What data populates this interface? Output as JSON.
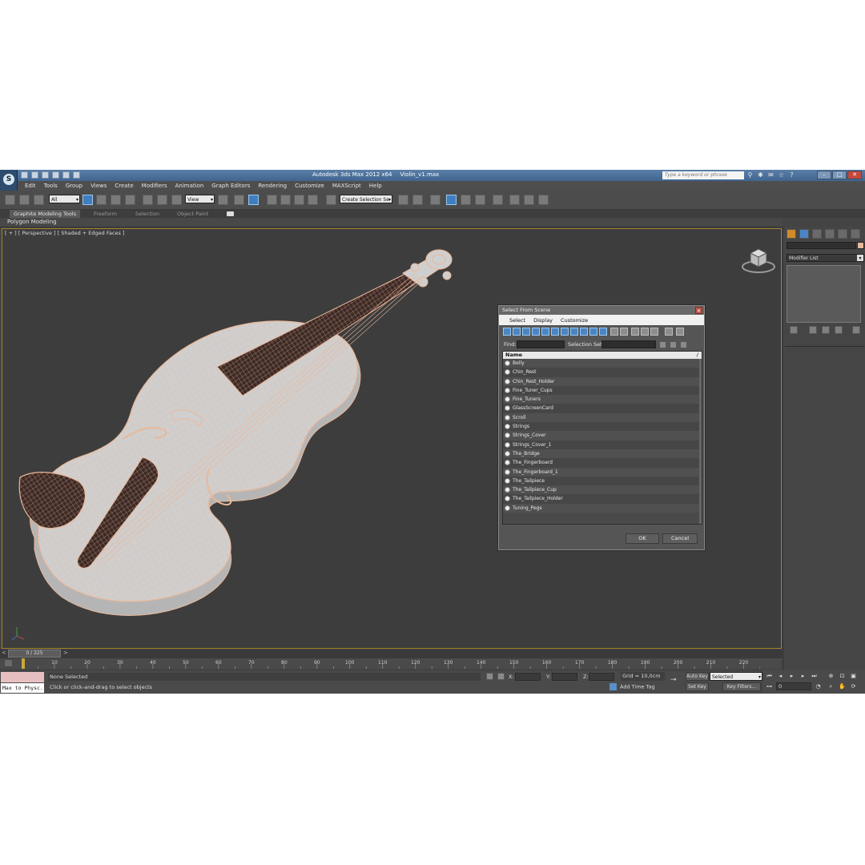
{
  "window": {
    "title": "Autodesk 3ds Max  2012 x64",
    "file": "Violin_v1.max",
    "search_placeholder": "Type a keyword or phrase"
  },
  "menu": [
    "Edit",
    "Tools",
    "Group",
    "Views",
    "Create",
    "Modifiers",
    "Animation",
    "Graph Editors",
    "Rendering",
    "Customize",
    "MAXScript",
    "Help"
  ],
  "toolbar": {
    "selection_filter": "All",
    "reference_coord": "View",
    "named_selection": "Create Selection Se"
  },
  "ribbon": {
    "tabs": [
      "Graphite Modeling Tools",
      "Freeform",
      "Selection",
      "Object Paint"
    ],
    "active_panel": "Polygon Modeling"
  },
  "viewport": {
    "label": "[ + ] [ Perspective ] [ Shaded + Edged Faces ]",
    "wire_color": "#e9b89a"
  },
  "dialog": {
    "title": "Select From Scene",
    "menu": [
      "Select",
      "Display",
      "Customize"
    ],
    "find_label": "Find:",
    "selection_set_label": "Selection Set:",
    "column_header": "Name",
    "sort_indicator": "/",
    "items": [
      "Belly",
      "Chin_Rest",
      "Chin_Rest_Holder",
      "Fine_Tuner_Cups",
      "Fine_Tuners",
      "GlassScreenCard",
      "Scroll",
      "Strings",
      "Strings_Cover",
      "Strings_Cover_1",
      "The_Bridge",
      "The_Fingerboard",
      "The_Fingerboard_1",
      "The_Tailpiece",
      "The_Tailpiece_Cup",
      "The_Tailpiece_Holder",
      "Tuning_Pegs"
    ],
    "ok_label": "OK",
    "cancel_label": "Cancel"
  },
  "command_panel": {
    "modifier_list": "Modifier List",
    "swatch_color": "#e8b79a"
  },
  "timeline": {
    "frame_display": "0 / 225",
    "ticks": [
      10,
      20,
      30,
      40,
      50,
      60,
      70,
      80,
      90,
      100,
      110,
      120,
      130,
      140,
      150,
      160,
      170,
      180,
      190,
      200,
      210,
      220
    ],
    "start": 0,
    "end": 225
  },
  "status": {
    "maxscript_output": "Max to Physc.",
    "selection": "None Selected",
    "prompt": "Click or click-and-drag to select objects",
    "x_label": "X:",
    "y_label": "Y:",
    "z_label": "Z:",
    "grid": "Grid = 10,0cm",
    "add_time_tag": "Add Time Tag",
    "auto_key": "Auto Key",
    "set_key": "Set Key",
    "key_mode": "Selected",
    "key_filters": "Key Filters...",
    "current_frame": "0"
  }
}
